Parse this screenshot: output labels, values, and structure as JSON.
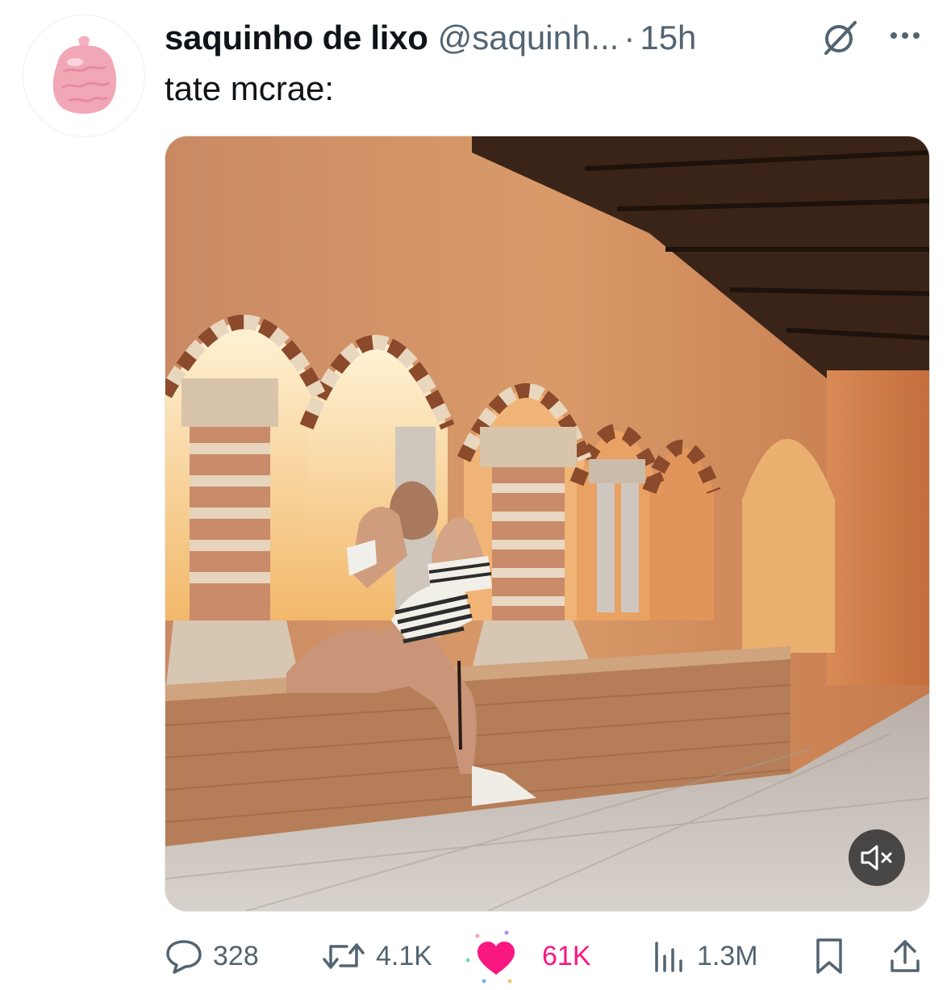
{
  "tweet": {
    "display_name": "saquinho de lixo",
    "handle": "@saquinh...",
    "separator": "·",
    "time": "15h",
    "text": "tate mcrae:"
  },
  "icons": {
    "avatar": "pink-trash-bag-avatar",
    "grok": "grok-icon",
    "more": "more-options-icon",
    "mute": "volume-muted-icon",
    "reply": "reply-bubble-icon",
    "retweet": "retweet-icon",
    "like": "heart-icon",
    "views": "views-bars-icon",
    "bookmark": "bookmark-icon",
    "share": "share-icon"
  },
  "actions": {
    "replies": "328",
    "retweets": "4.1K",
    "likes": "61K",
    "views": "1.3M"
  },
  "colors": {
    "text_primary": "#0f1419",
    "text_secondary": "#536471",
    "like_active": "#f91880",
    "avatar_bag": "#f2a7b7"
  }
}
